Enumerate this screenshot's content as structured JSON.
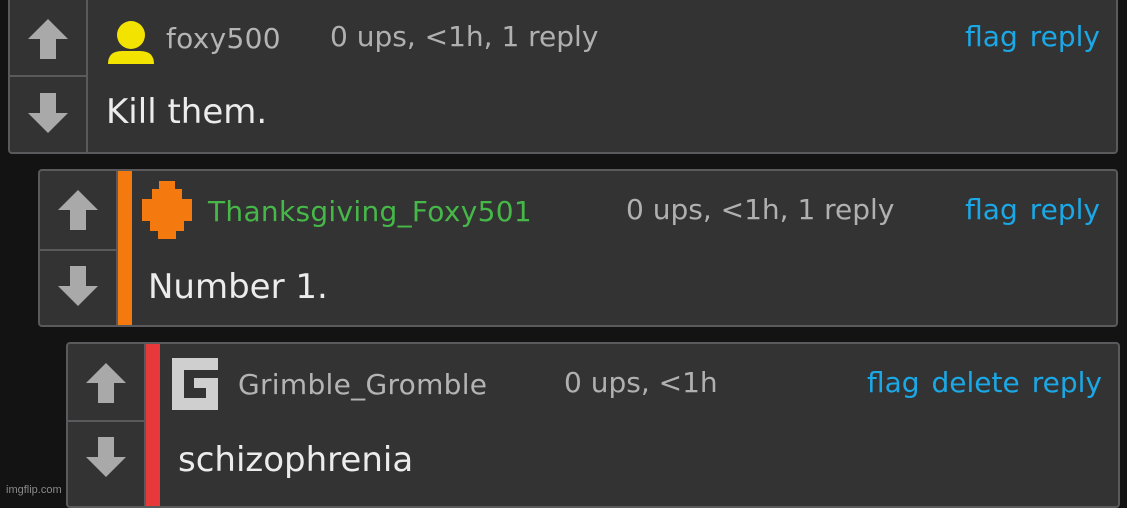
{
  "comments": [
    {
      "username": "foxy500",
      "meta": "0 ups, <1h, 1 reply",
      "body": "Kill them.",
      "actions": [
        "flag",
        "reply"
      ],
      "avatar_icon": "person-icon",
      "avatar_color": "#f2e400",
      "username_color": "#b4b4b4",
      "depth_bar_color": null
    },
    {
      "username": "Thanksgiving_Foxy501",
      "meta": "0 ups, <1h, 1 reply",
      "body": "Number 1.",
      "actions": [
        "flag",
        "reply"
      ],
      "avatar_icon": "pixel-cross-icon",
      "avatar_color": "#f47a10",
      "username_color": "#46b848",
      "depth_bar_color": "#f47a10"
    },
    {
      "username": "Grimble_Gromble",
      "meta": "0 ups, <1h",
      "body": "schizophrenia",
      "actions": [
        "flag",
        "delete",
        "reply"
      ],
      "avatar_icon": "letter-g-icon",
      "avatar_color": "#cfcfcf",
      "username_color": "#b4b4b4",
      "depth_bar_color": "#e8393a"
    }
  ],
  "watermark": "imgflip.com",
  "colors": {
    "background": "#131314",
    "card": "#333334",
    "border": "#5a5a5c",
    "link": "#1ba8e6",
    "meta": "#b0b0b0"
  }
}
